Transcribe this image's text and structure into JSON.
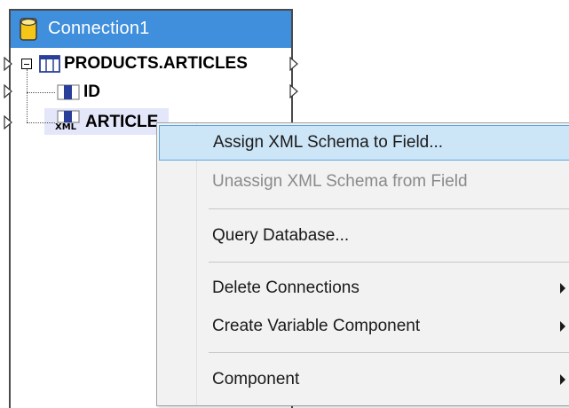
{
  "component": {
    "title": "Connection1",
    "header_color": "#3f8fdc",
    "rows": [
      {
        "label": "PRODUCTS.ARTICLES",
        "icon": "table-icon",
        "expanded": true
      },
      {
        "label": "ID",
        "icon": "field-icon"
      },
      {
        "label": "ARTICLE",
        "icon": "xml-field-icon",
        "icon_text": "XML",
        "highlighted": true
      }
    ]
  },
  "context_menu": {
    "items": [
      {
        "label": "Assign XML Schema to Field...",
        "state": "selected"
      },
      {
        "label": "Unassign XML Schema from Field",
        "state": "disabled"
      },
      {
        "label": "Query Database..."
      },
      {
        "label": "Delete Connections",
        "submenu": true
      },
      {
        "label": "Create Variable Component",
        "submenu": true
      },
      {
        "label": "Component",
        "submenu": true
      }
    ]
  }
}
